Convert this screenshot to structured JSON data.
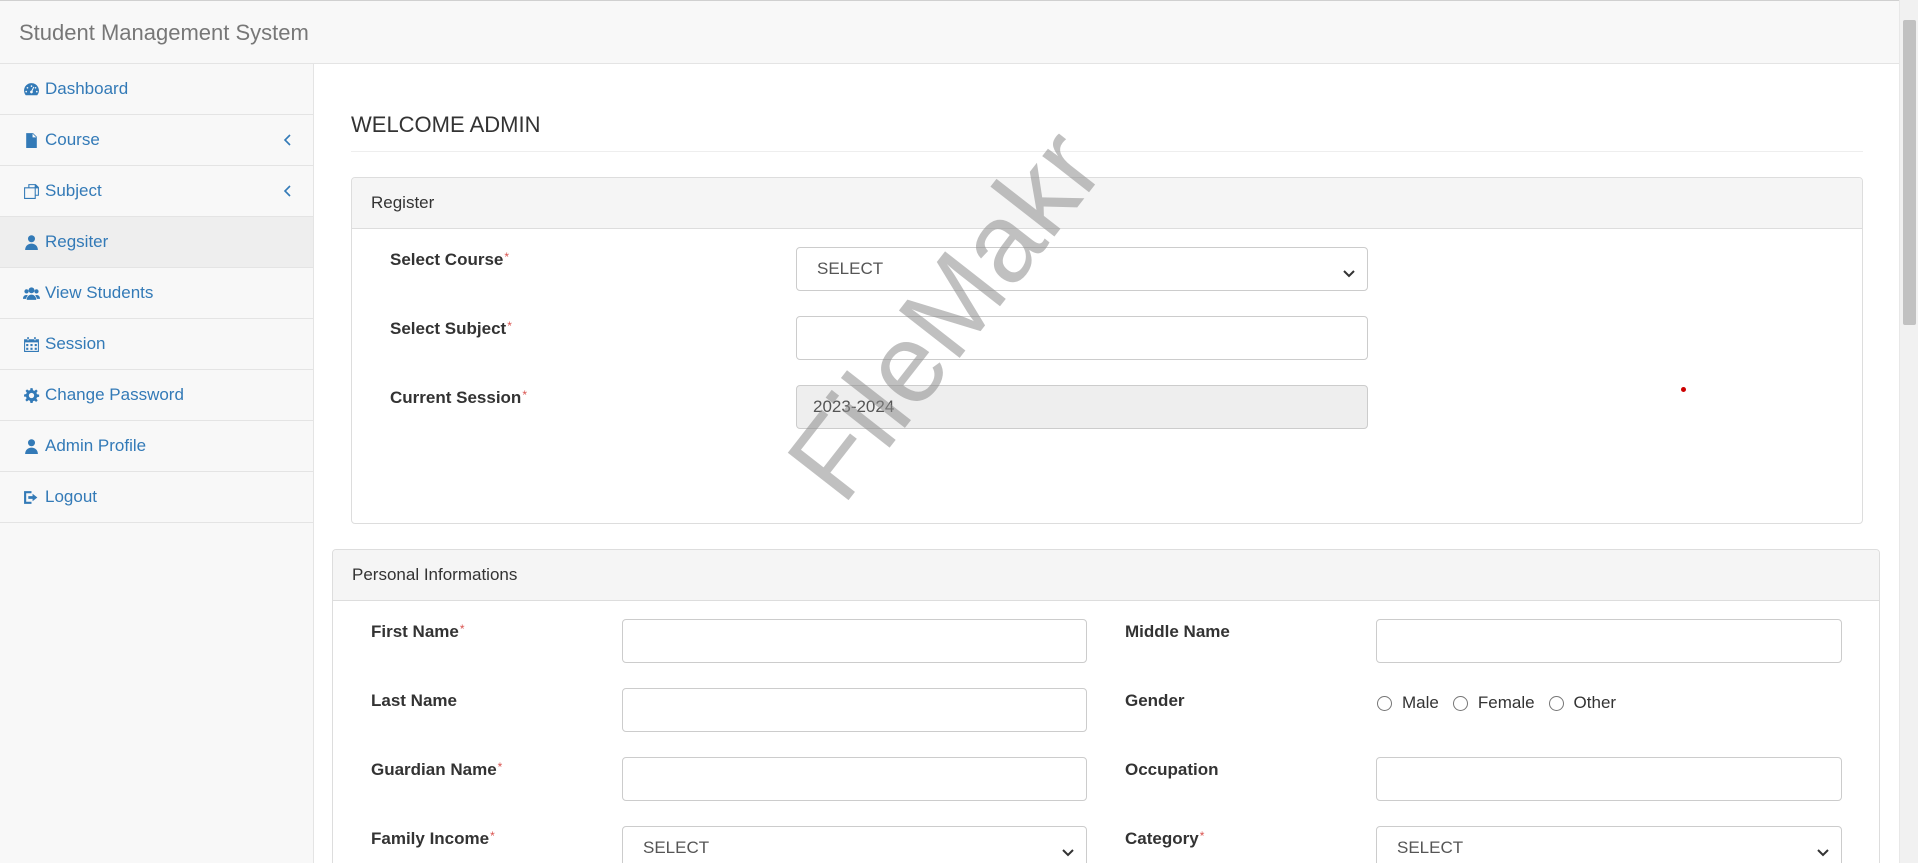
{
  "app": {
    "title": "Student Management System"
  },
  "sidebar": {
    "items": [
      {
        "label": "Dashboard",
        "icon": "dashboard-icon",
        "chevron": false,
        "active": false
      },
      {
        "label": "Course",
        "icon": "file-icon",
        "chevron": true,
        "active": false
      },
      {
        "label": "Subject",
        "icon": "copy-icon",
        "chevron": true,
        "active": false
      },
      {
        "label": "Regsiter",
        "icon": "user-icon",
        "chevron": false,
        "active": true
      },
      {
        "label": "View Students",
        "icon": "users-icon",
        "chevron": false,
        "active": false
      },
      {
        "label": "Session",
        "icon": "calendar-icon",
        "chevron": false,
        "active": false
      },
      {
        "label": "Change Password",
        "icon": "gear-icon",
        "chevron": false,
        "active": false
      },
      {
        "label": "Admin Profile",
        "icon": "user-icon",
        "chevron": false,
        "active": false
      },
      {
        "label": "Logout",
        "icon": "sign-out-icon",
        "chevron": false,
        "active": false
      }
    ]
  },
  "main": {
    "page_title": "WELCOME ADMIN",
    "register": {
      "heading": "Register",
      "course_label": "Select Course",
      "course_value": "SELECT",
      "subject_label": "Select Subject",
      "subject_value": "",
      "session_label": "Current Session",
      "session_value": "2023-2024"
    },
    "personal": {
      "heading": "Personal Informations",
      "first_name_label": "First Name",
      "first_name_value": "",
      "middle_name_label": "Middle Name",
      "middle_name_value": "",
      "last_name_label": "Last Name",
      "last_name_value": "",
      "gender_label": "Gender",
      "gender_options": [
        "Male",
        "Female",
        "Other"
      ],
      "guardian_label": "Guardian Name",
      "guardian_value": "",
      "occupation_label": "Occupation",
      "occupation_value": "",
      "income_label": "Family Income",
      "income_value": "SELECT",
      "category_label": "Category",
      "category_value": "SELECT"
    },
    "required_marker": "*"
  },
  "watermark": "FileMakr",
  "colors": {
    "link": "#337ab7",
    "required": "#d9534f",
    "panel_head": "#f5f5f5",
    "sidebar_bg": "#f8f8f8"
  }
}
